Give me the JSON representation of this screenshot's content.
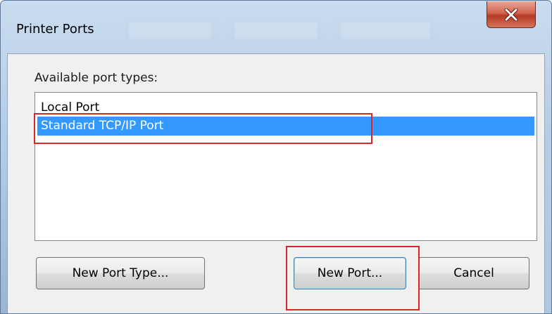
{
  "window": {
    "title": "Printer Ports"
  },
  "icons": {
    "close": "close-icon"
  },
  "list": {
    "label": "Available port types:",
    "items": [
      {
        "label": "Local Port",
        "selected": false
      },
      {
        "label": "Standard TCP/IP Port",
        "selected": true
      }
    ]
  },
  "buttons": {
    "new_port_type": "New Port Type...",
    "new_port": "New Port...",
    "cancel": "Cancel"
  },
  "colors": {
    "selection": "#3399ff",
    "highlight_annotation": "#d9262b",
    "close_button": "#c7503a"
  }
}
